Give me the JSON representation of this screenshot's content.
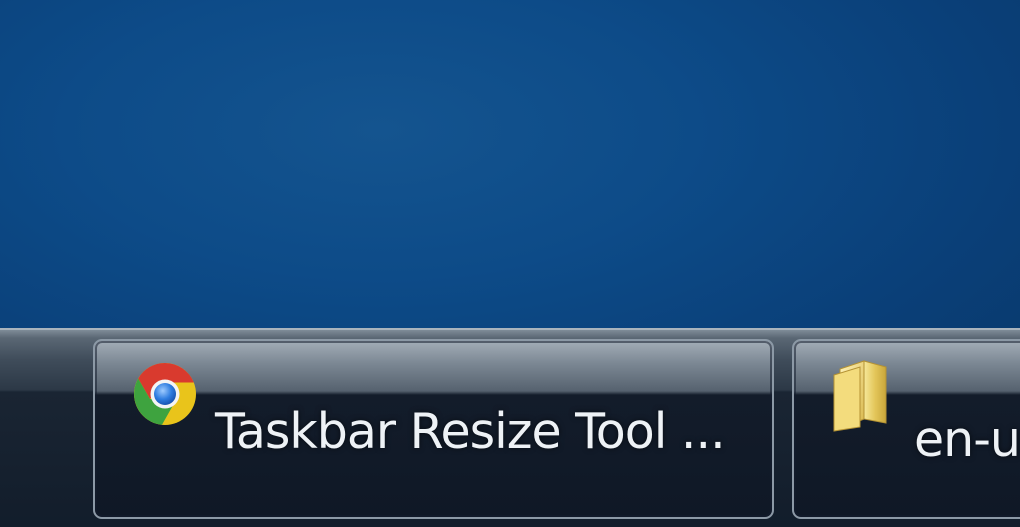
{
  "taskbar": {
    "items": [
      {
        "label": "Taskbar Resize Tool ...",
        "icon": "chrome-icon",
        "active": false
      },
      {
        "label": "en-u",
        "icon": "folder-icon",
        "active": false
      }
    ]
  },
  "colors": {
    "desktop": "#0d4b88",
    "taskbar": "#121d2b",
    "label": "#eef2f6"
  }
}
